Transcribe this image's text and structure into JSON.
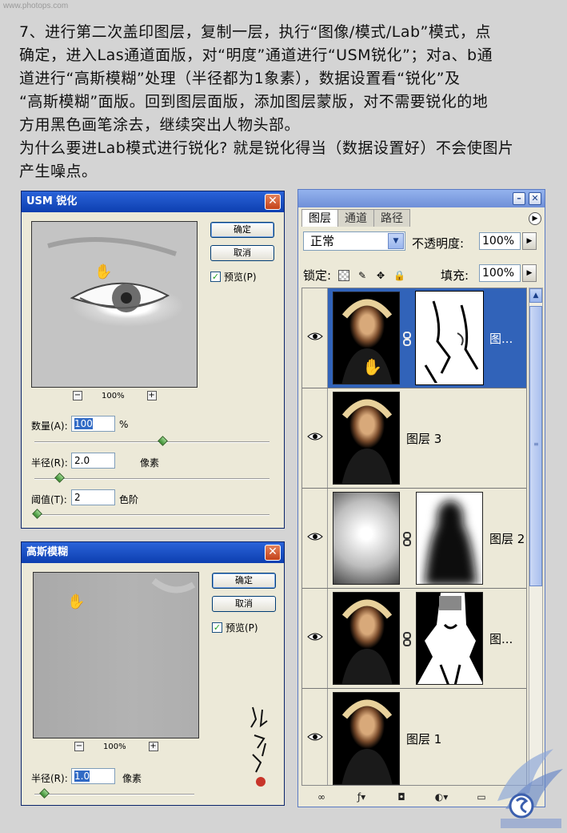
{
  "watermark": "www.photops.com",
  "instructions": [
    "7、进行第二次盖印图层，复制一层，执行“图像/模式/Lab”模式，点",
    "确定，进入Las通道面版，对“明度”通道进行“USM锐化”；对a、b通",
    "道进行“高斯模糊”处理（半径都为1象素），数据设置看“锐化”及",
    "“高斯模糊”面版。回到图层面版，添加图层蒙版，对不需要锐化的地",
    "方用黑色画笔涂去，继续突出人物头部。",
    "为什么要进Lab模式进行锐化? 就是锐化得当（数据设置好）不会使图片",
    "产生噪点。"
  ],
  "usm_dialog": {
    "title": "USM 锐化",
    "ok": "确定",
    "cancel": "取消",
    "preview": "预览(P)",
    "preview_check": "✓",
    "zoom": "100%",
    "amount_label": "数量(A):",
    "amount_value": "100",
    "amount_unit": "%",
    "radius_label": "半径(R):",
    "radius_value": "2.0",
    "radius_unit": "像素",
    "threshold_label": "阈值(T):",
    "threshold_value": "2",
    "threshold_unit": "色阶"
  },
  "gauss_dialog": {
    "title": "高斯模糊",
    "ok": "确定",
    "cancel": "取消",
    "preview": "预览(P)",
    "preview_check": "✓",
    "zoom": "100%",
    "radius_label": "半径(R):",
    "radius_value": "1.0",
    "radius_unit": "像素"
  },
  "layers_panel": {
    "tabs": [
      "图层",
      "通道",
      "路径"
    ],
    "blend_mode": "正常",
    "opacity_label": "不透明度:",
    "opacity_value": "100%",
    "lock_label": "锁定:",
    "fill_label": "填充:",
    "fill_value": "100%",
    "layers": [
      {
        "name": "图...",
        "selected": true
      },
      {
        "name": "图层 3",
        "selected": false
      },
      {
        "name": "图层 2",
        "selected": false
      },
      {
        "name": "图...",
        "selected": false
      },
      {
        "name": "图层 1",
        "selected": false
      }
    ]
  },
  "colors": {
    "title_bar": "#0d3fb0",
    "selected_layer": "#3163b9",
    "dialog_bg": "#ece9d8"
  }
}
